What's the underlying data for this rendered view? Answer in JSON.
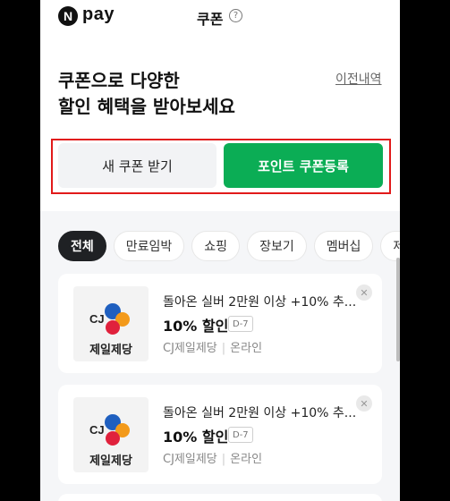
{
  "header": {
    "logo_n": "N",
    "logo_text": "pay",
    "title": "쿠폰",
    "help_glyph": "?"
  },
  "intro": {
    "line1": "쿠폰으로 다양한",
    "line2": "할인 혜택을 받아보세요",
    "history_link": "이전내역"
  },
  "actions": {
    "new_coupon": "새 쿠폰 받기",
    "point_coupon": "포인트 쿠폰등록"
  },
  "filters": [
    {
      "label": "전체",
      "active": true
    },
    {
      "label": "만료임박",
      "active": false
    },
    {
      "label": "쇼핑",
      "active": false
    },
    {
      "label": "장보기",
      "active": false
    },
    {
      "label": "멤버십",
      "active": false
    },
    {
      "label": "제",
      "active": false
    }
  ],
  "coupons": [
    {
      "logo_letters": "CJ",
      "brand": "제일제당",
      "title": "돌아온 실버 2만원 이상 +10% 추...",
      "discount": "10% 할인",
      "dday": "D-7",
      "merchant": "CJ제일제당",
      "channel": "온라인",
      "close": "✕"
    },
    {
      "logo_letters": "CJ",
      "brand": "제일제당",
      "title": "돌아온 실버 2만원 이상 +10% 추...",
      "discount": "10% 할인",
      "dday": "D-7",
      "merchant": "CJ제일제당",
      "channel": "온라인",
      "close": "✕"
    }
  ],
  "colors": {
    "accent_green": "#0bad55",
    "highlight_red": "#e11a1a",
    "cj_blue": "#1f5fbf",
    "cj_orange": "#f39a1b",
    "cj_red": "#e0213c"
  }
}
